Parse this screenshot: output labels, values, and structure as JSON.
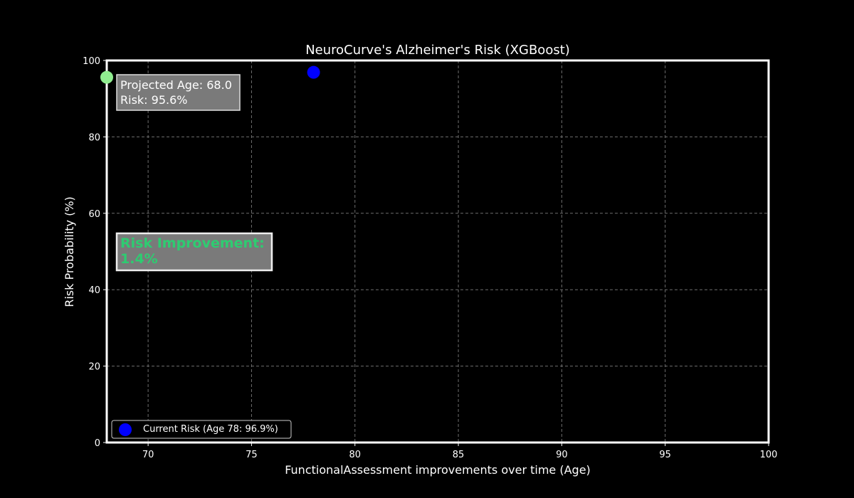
{
  "chart_data": {
    "type": "scatter",
    "title": "NeuroCurve's Alzheimer's Risk (XGBoost)",
    "xlabel": "FunctionalAssessment improvements over time (Age)",
    "ylabel": "Risk Probability (%)",
    "xlim": [
      68,
      100
    ],
    "ylim": [
      0,
      100
    ],
    "xticks": [
      70,
      75,
      80,
      85,
      90,
      95,
      100
    ],
    "yticks": [
      0,
      20,
      40,
      60,
      80,
      100
    ],
    "grid": true,
    "legend_position": "lower-left",
    "series": [
      {
        "name": "Current Risk (Age 78: 96.9%)",
        "color": "#0000ff",
        "points": [
          {
            "x": 78,
            "y": 96.9
          }
        ]
      },
      {
        "color": "#90ee90",
        "points": [
          {
            "x": 68,
            "y": 95.6
          }
        ]
      }
    ],
    "annotations": {
      "projection_line1": "Projected Age: 68.0",
      "projection_line2": "Risk: 95.6%",
      "improvement_line1": "Risk Improvement:",
      "improvement_line2": "1.4%"
    },
    "colors": {
      "background": "#000000",
      "foreground": "#ffffff",
      "grid": "#6e6e6e",
      "improvement_text": "#2ecc71",
      "annotation_box": "#7a7a7a"
    }
  }
}
